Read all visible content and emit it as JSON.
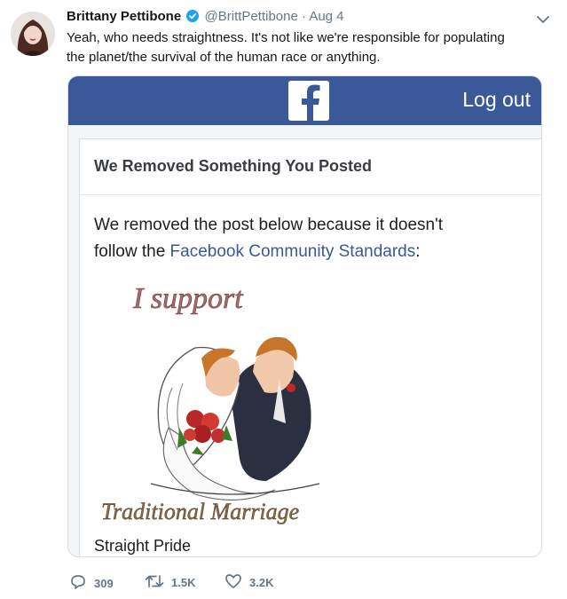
{
  "tweet": {
    "author_name": "Brittany Pettibone",
    "handle": "@BrittPettibone",
    "separator": "·",
    "date": "Aug 4",
    "text_line1": "Yeah, who needs straightness. It's not like we're responsible for populating",
    "text_line2": "the planet/the survival of the human race or anything.",
    "avatar_icon": "user-avatar",
    "verified_icon": "verified-badge-icon",
    "menu_icon": "chevron-down-icon"
  },
  "embedded": {
    "logout_label": "Log out",
    "logo_icon": "facebook-logo-icon",
    "notice_title": "We Removed Something You Posted",
    "notice_line1": "We removed the post below because it doesn't",
    "notice_line2_prefix": "follow the ",
    "notice_link": "Facebook Community Standards",
    "notice_suffix": ":",
    "image_top_text": "I support",
    "image_bottom_text": "Traditional Marriage",
    "caption": "Straight Pride"
  },
  "actions": {
    "replies": "309",
    "retweets": "1.5K",
    "likes": "3.2K"
  },
  "colors": {
    "facebook_blue": "#3b5998",
    "link_blue": "#385898",
    "verified_blue": "#1da1f2",
    "muted": "#657786"
  }
}
